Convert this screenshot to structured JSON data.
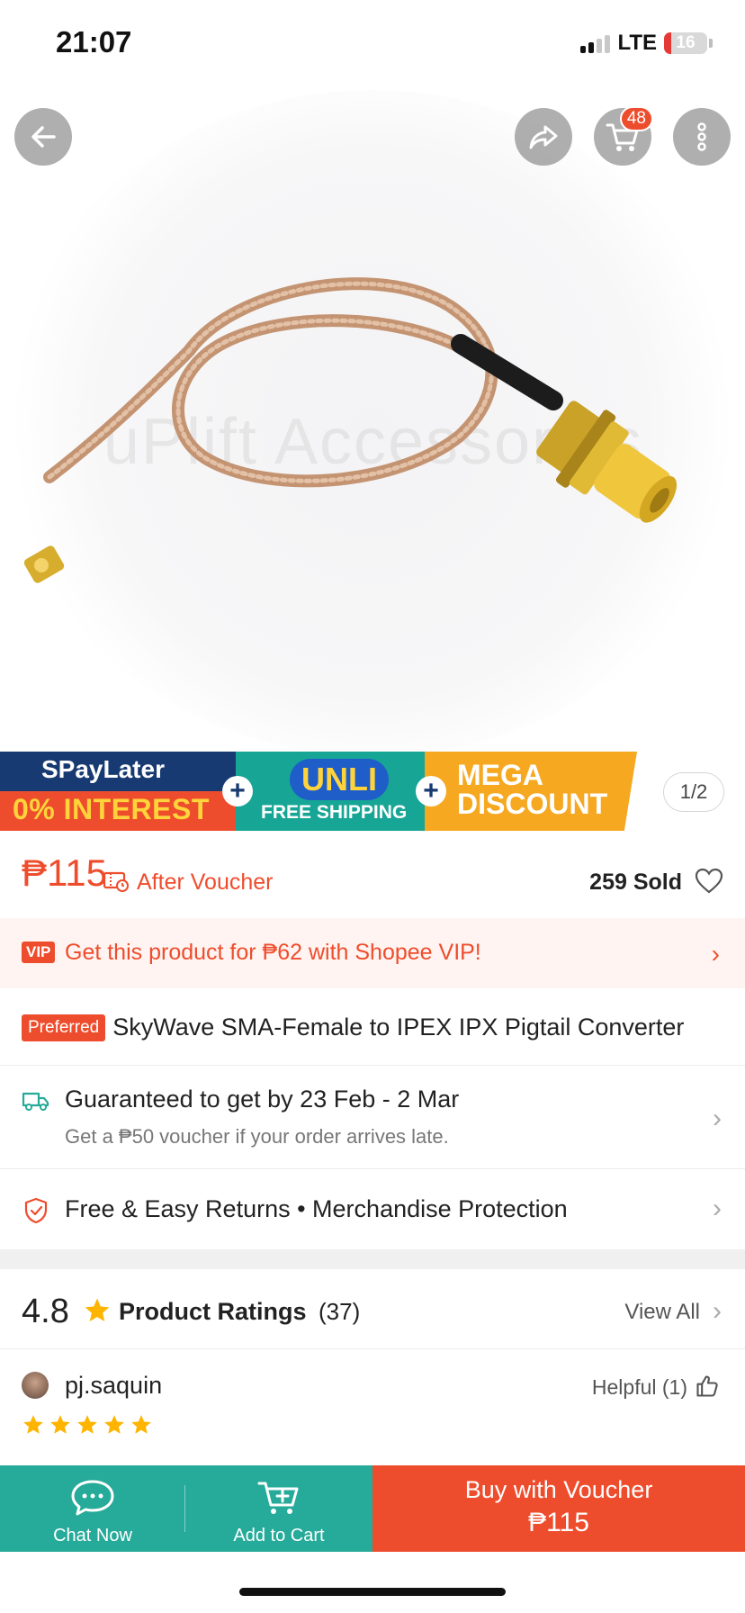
{
  "status_bar": {
    "time": "21:07",
    "network": "LTE",
    "battery": "16"
  },
  "hero": {
    "watermark": "uPlift Accessories",
    "cart_count": "48",
    "image_page": "1/2"
  },
  "promo": {
    "spaylater": "SPayLater",
    "interest": "0% INTEREST",
    "unli": "UNLI",
    "free_shipping": "FREE SHIPPING",
    "mega_line1": "MEGA",
    "mega_line2": "DISCOUNT"
  },
  "price": {
    "value": "₱115",
    "after_voucher": "After Voucher",
    "sold": "259 Sold"
  },
  "vip": {
    "badge": "VIP",
    "text": "Get this product for ₱62 with Shopee VIP!"
  },
  "product": {
    "preferred_badge": "Preferred",
    "title": "SkyWave SMA-Female to IPEX IPX Pigtail Converter"
  },
  "shipping": {
    "main": "Guaranteed to get by 23 Feb - 2 Mar",
    "sub": "Get a ₱50 voucher if your order arrives late."
  },
  "returns": {
    "text": "Free & Easy Returns  •  Merchandise Protection"
  },
  "ratings": {
    "score": "4.8",
    "label": "Product Ratings",
    "count": "(37)",
    "view_all": "View All"
  },
  "review": {
    "username": "pj.saquin",
    "helpful": "Helpful (1)",
    "stars": 5
  },
  "bottom_bar": {
    "chat": "Chat Now",
    "add_to_cart": "Add to Cart",
    "buy_line1": "Buy with Voucher",
    "buy_line2": "₱115"
  },
  "colors": {
    "accent": "#ee4d2d",
    "teal": "#26aa99",
    "star": "#ffb400"
  }
}
